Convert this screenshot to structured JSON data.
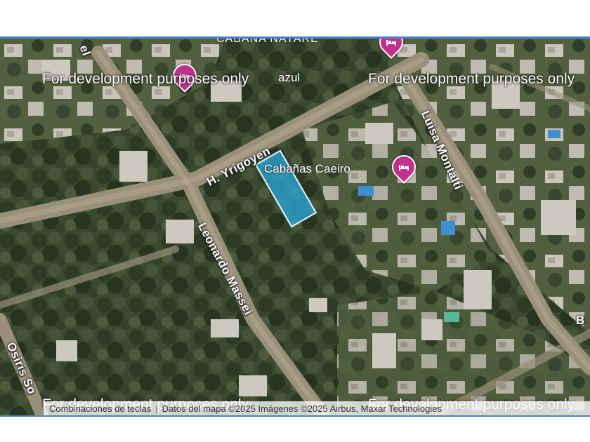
{
  "map": {
    "watermark": "For development purposes only",
    "streets": {
      "yrigoyen": "H. Yrigoyen",
      "massei": "Leonardo Massei",
      "montalti": "Luisa Montalti",
      "osiris": "Osiris So",
      "top_left": "el",
      "right_edge": "B"
    },
    "pois": {
      "caeiro": "Cabañas Caeiro",
      "nayare": "CABAÑA NAYARE",
      "azul": "azul"
    },
    "parcel_color": "#28aadc",
    "pin_color": "#c0318d",
    "attribution": {
      "shortcuts": "Combinaciones de teclas",
      "map_data": "Datos del mapa ©2025 Imágenes ©2025 Airbus, Maxar Technologies"
    }
  }
}
